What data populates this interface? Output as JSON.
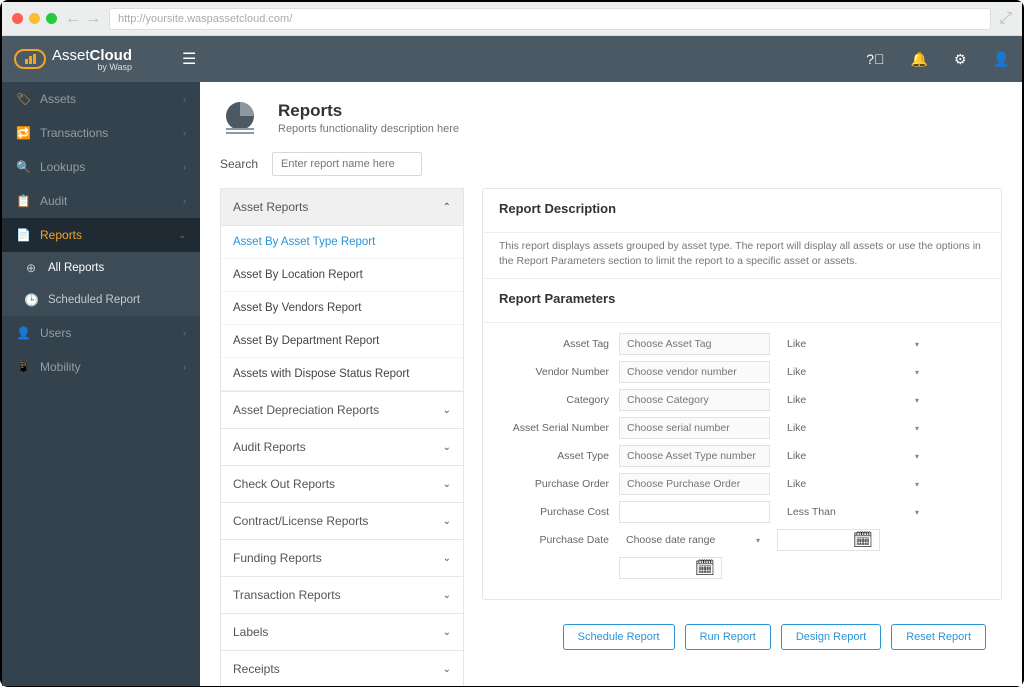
{
  "browser": {
    "url": "http://yoursite.waspassetcloud.com/"
  },
  "brand": {
    "name_a": "Asset",
    "name_b": "Cloud",
    "byline": "by Wasp"
  },
  "sidebar": {
    "items": [
      {
        "label": "Assets",
        "icon": "🏷"
      },
      {
        "label": "Transactions",
        "icon": "🔁"
      },
      {
        "label": "Lookups",
        "icon": "🔍"
      },
      {
        "label": "Audit",
        "icon": "📋"
      },
      {
        "label": "Reports",
        "icon": "📄",
        "active": true
      },
      {
        "label": "Users",
        "icon": "👤"
      },
      {
        "label": "Mobility",
        "icon": "📱"
      }
    ],
    "report_subs": [
      {
        "label": "All Reports",
        "icon": "⊕",
        "sel": true
      },
      {
        "label": "Scheduled Report",
        "icon": "🕒"
      }
    ]
  },
  "page": {
    "title": "Reports",
    "subtitle": "Reports functionality description here",
    "search_label": "Search",
    "search_placeholder": "Enter report name here"
  },
  "report_tree": {
    "expanded": "Asset Reports",
    "expanded_items": [
      "Asset By Asset Type Report",
      "Asset By Location Report",
      "Asset By Vendors Report",
      "Asset By Department Report",
      "Assets with Dispose Status Report"
    ],
    "selected": "Asset By Asset Type Report",
    "collapsed": [
      "Asset Depreciation Reports",
      "Audit Reports",
      "Check Out Reports",
      "Contract/License Reports",
      "Funding Reports",
      "Transaction Reports",
      "Labels",
      "Receipts"
    ]
  },
  "desc": {
    "title": "Report Description",
    "text": "This report displays assets grouped by asset type. The report will display all assets or use the options in the Report Parameters section to limit the report to a specific asset or assets."
  },
  "params": {
    "title": "Report Parameters",
    "rows": [
      {
        "label": "Asset Tag",
        "ph": "Choose Asset Tag",
        "op": "Like"
      },
      {
        "label": "Vendor Number",
        "ph": "Choose vendor number",
        "op": "Like"
      },
      {
        "label": "Category",
        "ph": "Choose Category",
        "op": "Like"
      },
      {
        "label": "Asset Serial Number",
        "ph": "Choose serial number",
        "op": "Like"
      },
      {
        "label": "Asset Type",
        "ph": "Choose Asset Type number",
        "op": "Like"
      },
      {
        "label": "Purchase Order",
        "ph": "Choose Purchase Order",
        "op": "Like"
      },
      {
        "label": "Purchase Cost",
        "ph": "",
        "op": "Less Than",
        "white": true
      },
      {
        "label": "Purchase Date",
        "ph": "Choose date range",
        "date": true
      }
    ]
  },
  "buttons": [
    "Schedule Report",
    "Run Report",
    "Design Report",
    "Reset Report"
  ]
}
